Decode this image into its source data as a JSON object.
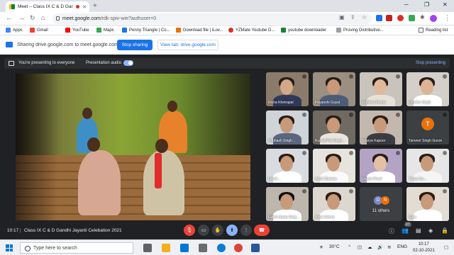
{
  "browser": {
    "tab_title": "Meet – Class IX C & D Gandhi",
    "url_host": "meet.google.com",
    "url_path": "/rdk-spiv-wie?authuser=0",
    "bookmarks": [
      "Apps",
      "Gmail",
      "YouTube",
      "Maps",
      "Penny Triangle | Co...",
      "Download file | iLov...",
      "YZMate Youtube D...",
      "youtube downloader",
      "Proving Distributive..."
    ],
    "reading_list": "Reading list"
  },
  "share_bar": {
    "text": "Sharing drive.google.com to meet.google.com",
    "stop_label": "Stop sharing",
    "view_label": "View tab: drive.google.com"
  },
  "presenting": {
    "text": "You're presenting to everyone",
    "audio_label": "Presentation audio",
    "stop_label": "Stop presenting"
  },
  "participants": [
    {
      "name": "Richa Khetrapal"
    },
    {
      "name": "Priyanshi Goyal"
    },
    {
      "name": "Vidhima Pande"
    },
    {
      "name": "Umisha Singh"
    },
    {
      "name": "Subhash Singh..."
    },
    {
      "name": "Kushal Pal Singh..."
    },
    {
      "name": "Sharya Kapoor"
    },
    {
      "name": "Tanveer Singh Guron",
      "initial": "T"
    },
    {
      "name": "Laksh..."
    },
    {
      "name": "Ansh Sharma"
    },
    {
      "name": "Ursula Pirzel"
    },
    {
      "name": "Tanya Ka..."
    },
    {
      "name": "Fateh Imaan Sing..."
    },
    {
      "name": "Ahva Verma"
    },
    {
      "others_label": "11 others",
      "initials": [
        "D",
        "N"
      ]
    },
    {
      "name": "Sara"
    }
  ],
  "meeting": {
    "time": "10:17",
    "separator": "|",
    "title": "Class IX C & D Gandhi Jayanti Celebation 2021",
    "people_count": "27"
  },
  "taskbar": {
    "search_placeholder": "Type here to search",
    "weather": "30°C",
    "lang": "ENG",
    "clock_time": "10:17",
    "clock_date": "02-10-2021"
  }
}
